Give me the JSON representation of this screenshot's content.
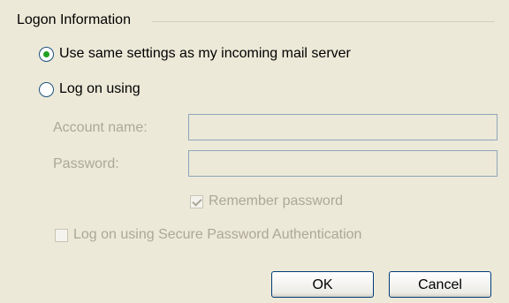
{
  "group": {
    "title": "Logon Information"
  },
  "radios": {
    "same_settings_label": "Use same settings as my incoming mail server",
    "log_on_using_label": "Log on using"
  },
  "fields": {
    "account_name_label": "Account name:",
    "password_label": "Password:"
  },
  "checkboxes": {
    "remember_password_label": "Remember password",
    "spa_label": "Log on using Secure Password Authentication"
  },
  "buttons": {
    "ok_label": "OK",
    "cancel_label": "Cancel"
  }
}
